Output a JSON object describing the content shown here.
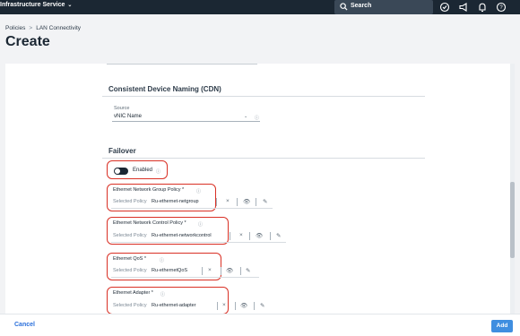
{
  "header": {
    "app_name": "Infrastructure Service",
    "search_label": "Search"
  },
  "breadcrumb": {
    "items": [
      "Policies",
      "LAN Connectivity"
    ],
    "separator": ">"
  },
  "page_title": "Create",
  "cdn": {
    "title": "Consistent Device Naming (CDN)",
    "source_label": "Source",
    "source_value": "vNIC Name"
  },
  "failover": {
    "title": "Failover",
    "toggle_label": "Enabled",
    "enabled": true
  },
  "policies": [
    {
      "label": "Ethernet Network Group Policy *",
      "selected_label": "Selected Policy",
      "value": "Ru-ethernet-netgroup"
    },
    {
      "label": "Ethernet Network Control Policy *",
      "selected_label": "Selected Policy",
      "value": "Ru-ethernet-networkcontrol"
    },
    {
      "label": "Ethernet QoS *",
      "selected_label": "Selected Policy",
      "value": "Ru-ethernetQoS"
    },
    {
      "label": "Ethernet Adapter *",
      "selected_label": "Selected Policy",
      "value": "Ru-ethernet-adapter"
    }
  ],
  "footer": {
    "cancel_label": "Cancel",
    "add_label": "Add"
  },
  "colors": {
    "accent": "#3f8ee0",
    "highlight": "#d93025",
    "header_bg": "#1b2733"
  },
  "icons": [
    "chevron-down-icon",
    "search-icon",
    "check-circle-icon",
    "megaphone-icon",
    "bell-icon",
    "help-icon",
    "info-icon",
    "clear-icon",
    "eye-icon",
    "edit-icon"
  ]
}
